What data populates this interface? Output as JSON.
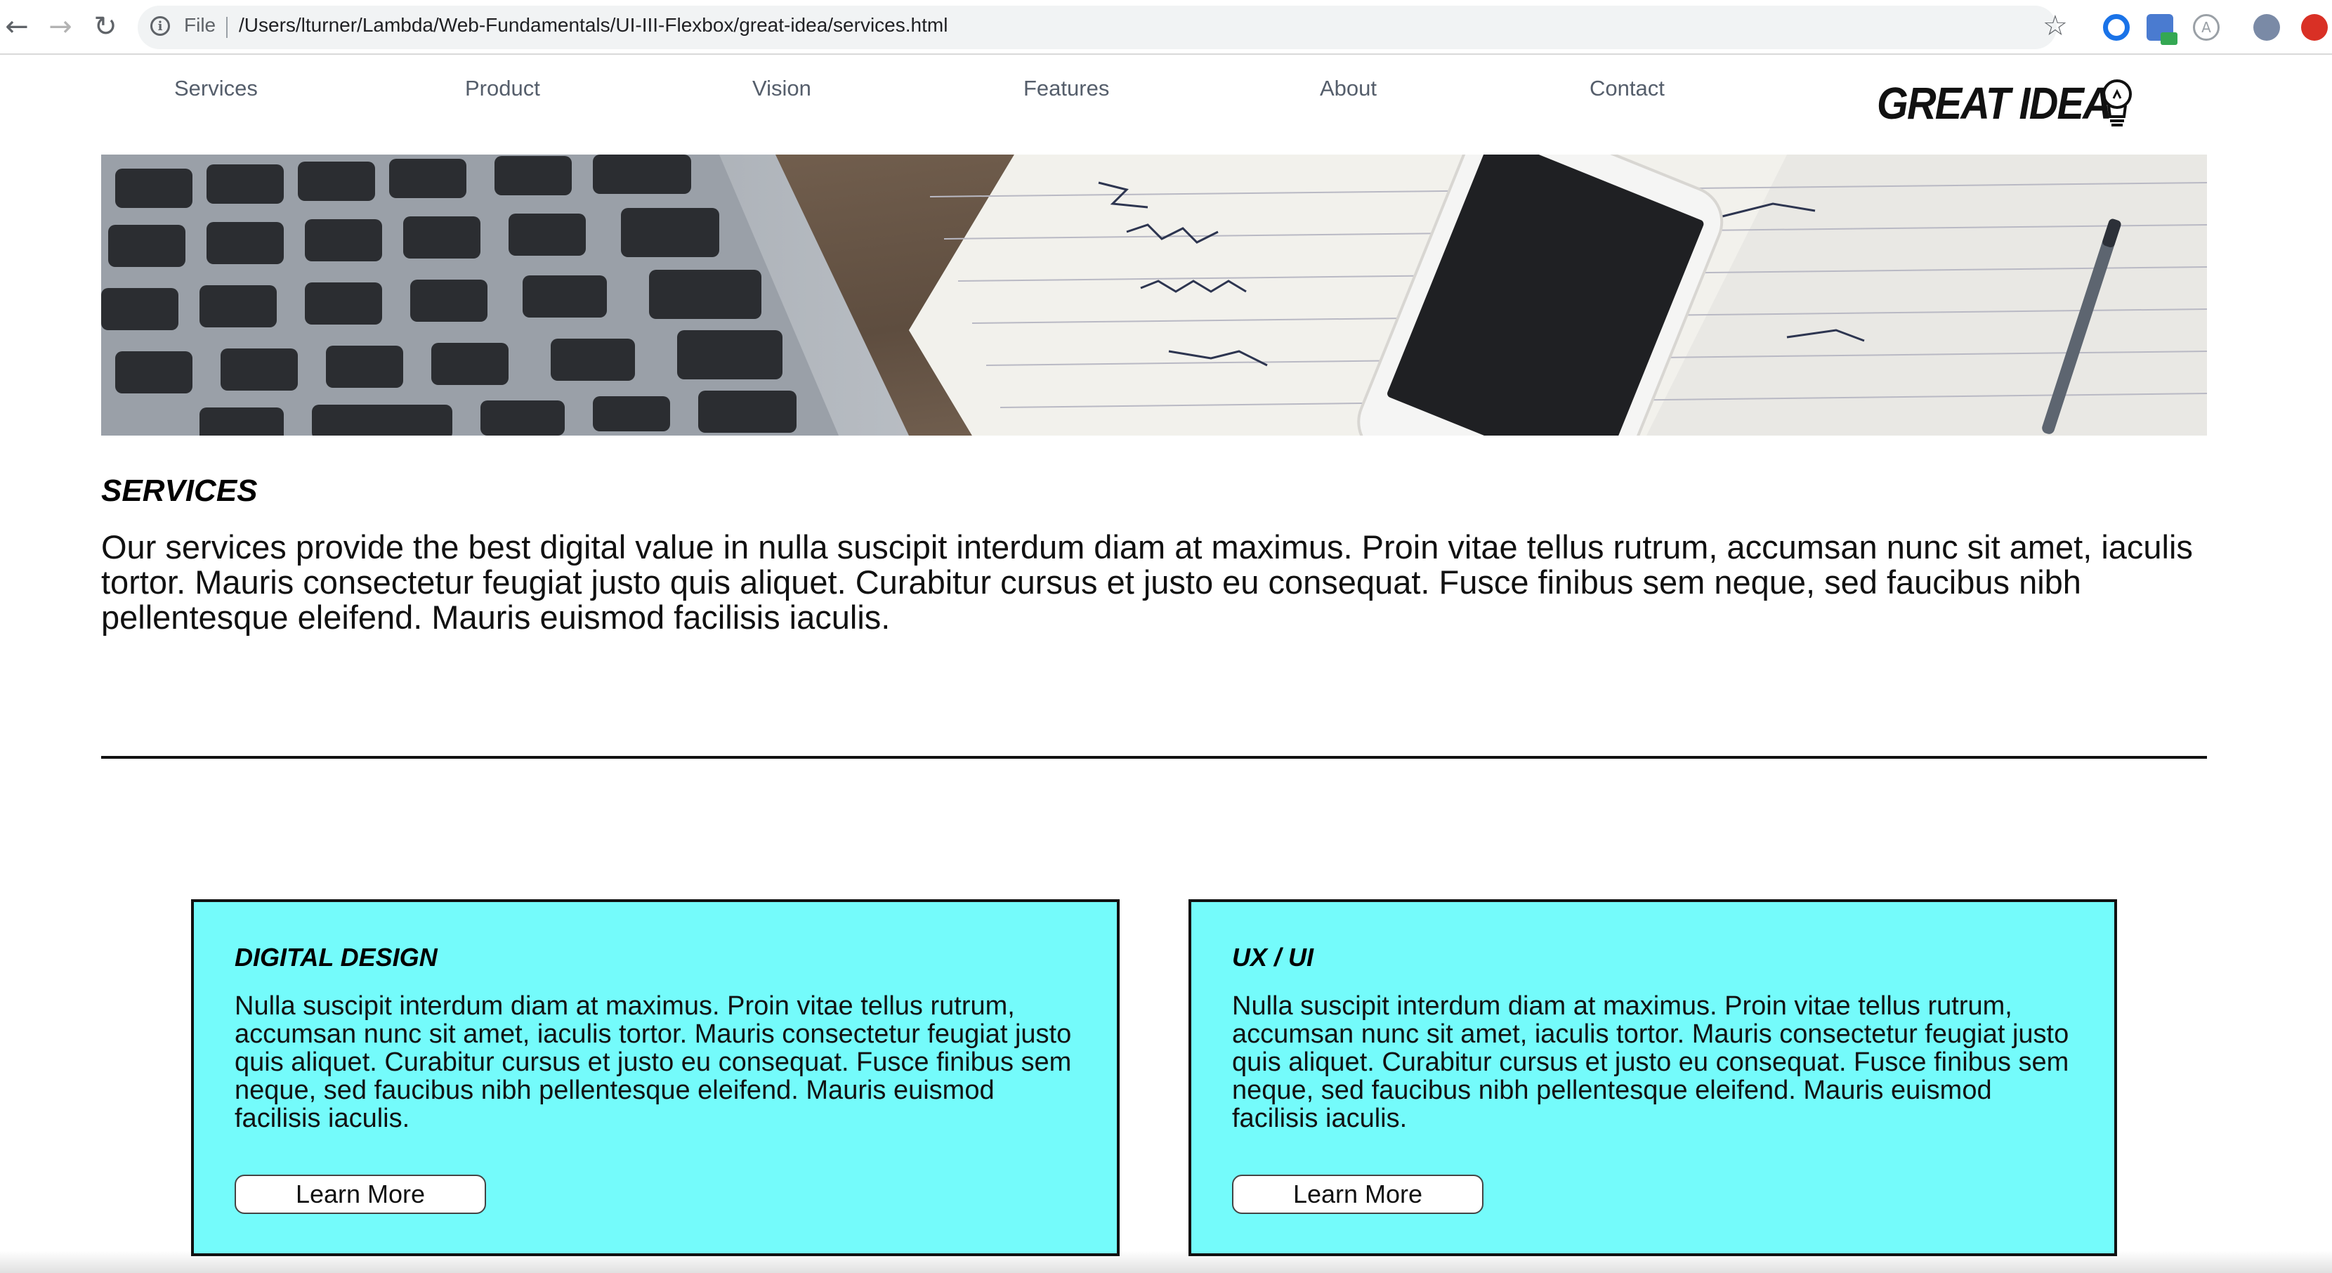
{
  "browser": {
    "file_label": "File",
    "url": "/Users/lturner/Lambda/Web-Fundamentals/UI-III-Flexbox/great-idea/services.html"
  },
  "nav": {
    "items": [
      {
        "label": "Services"
      },
      {
        "label": "Product"
      },
      {
        "label": "Vision"
      },
      {
        "label": "Features"
      },
      {
        "label": "About"
      },
      {
        "label": "Contact"
      }
    ],
    "logo_text": "GREAT IDEA"
  },
  "section": {
    "title": "Services",
    "intro": "Our services provide the best digital value in nulla suscipit interdum diam at maximus. Proin vitae tellus rutrum, accumsan nunc sit amet, iaculis tortor. Mauris consectetur feugiat justo quis aliquet. Curabitur cursus et justo eu consequat. Fusce finibus sem neque, sed faucibus nibh pellentesque eleifend. Mauris euismod facilisis iaculis."
  },
  "cards": [
    {
      "title": "Digital Design",
      "text": "Nulla suscipit interdum diam at maximus. Proin vitae tellus rutrum, accumsan nunc sit amet, iaculis tortor. Mauris consectetur feugiat justo quis aliquet. Curabitur cursus et justo eu consequat. Fusce finibus sem neque, sed faucibus nibh pellentesque eleifend. Mauris euismod facilisis iaculis.",
      "button_label": "Learn More"
    },
    {
      "title": "UX / UI",
      "text": "Nulla suscipit interdum diam at maximus. Proin vitae tellus rutrum, accumsan nunc sit amet, iaculis tortor. Mauris consectetur feugiat justo quis aliquet. Curabitur cursus et justo eu consequat. Fusce finibus sem neque, sed faucibus nibh pellentesque eleifend. Mauris euismod facilisis iaculis.",
      "button_label": "Learn More"
    }
  ],
  "colors": {
    "card_background": "#74fbfb",
    "nav_text": "#555e6b",
    "divider": "#111111"
  },
  "icons": [
    "back-arrow-icon",
    "forward-arrow-icon",
    "reload-icon",
    "info-icon",
    "star-icon",
    "lightbulb-icon"
  ]
}
